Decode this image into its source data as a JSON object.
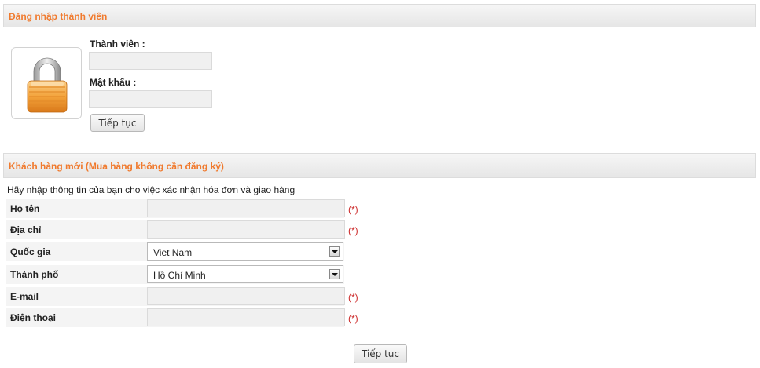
{
  "login": {
    "header": "Đăng nhập thành viên",
    "member_label": "Thành viên :",
    "password_label": "Mật khẩu :",
    "submit_label": "Tiếp tục",
    "member_value": "",
    "password_value": ""
  },
  "guest": {
    "header": "Khách hàng mới (Mua hàng không cần đăng ký)",
    "intro": "Hãy nhập thông tin của bạn cho việc xác nhận hóa đơn và giao hàng",
    "required_mark": "(*)",
    "fields": {
      "name": {
        "label": "Họ tên",
        "value": ""
      },
      "address": {
        "label": "Địa chỉ",
        "value": ""
      },
      "country": {
        "label": "Quốc gia",
        "selected": "Viet Nam"
      },
      "city": {
        "label": "Thành phố",
        "selected": "Hồ Chí Minh"
      },
      "email": {
        "label": "E-mail",
        "value": ""
      },
      "phone": {
        "label": "Điện thoại",
        "value": ""
      }
    },
    "submit_label": "Tiếp tục"
  },
  "colors": {
    "header_text": "#f07a2e",
    "required": "#cc2a2a",
    "lock_body": "#f3a23a"
  },
  "icons": {
    "lock": "padlock-icon",
    "dropdown": "chevron-down-icon"
  }
}
